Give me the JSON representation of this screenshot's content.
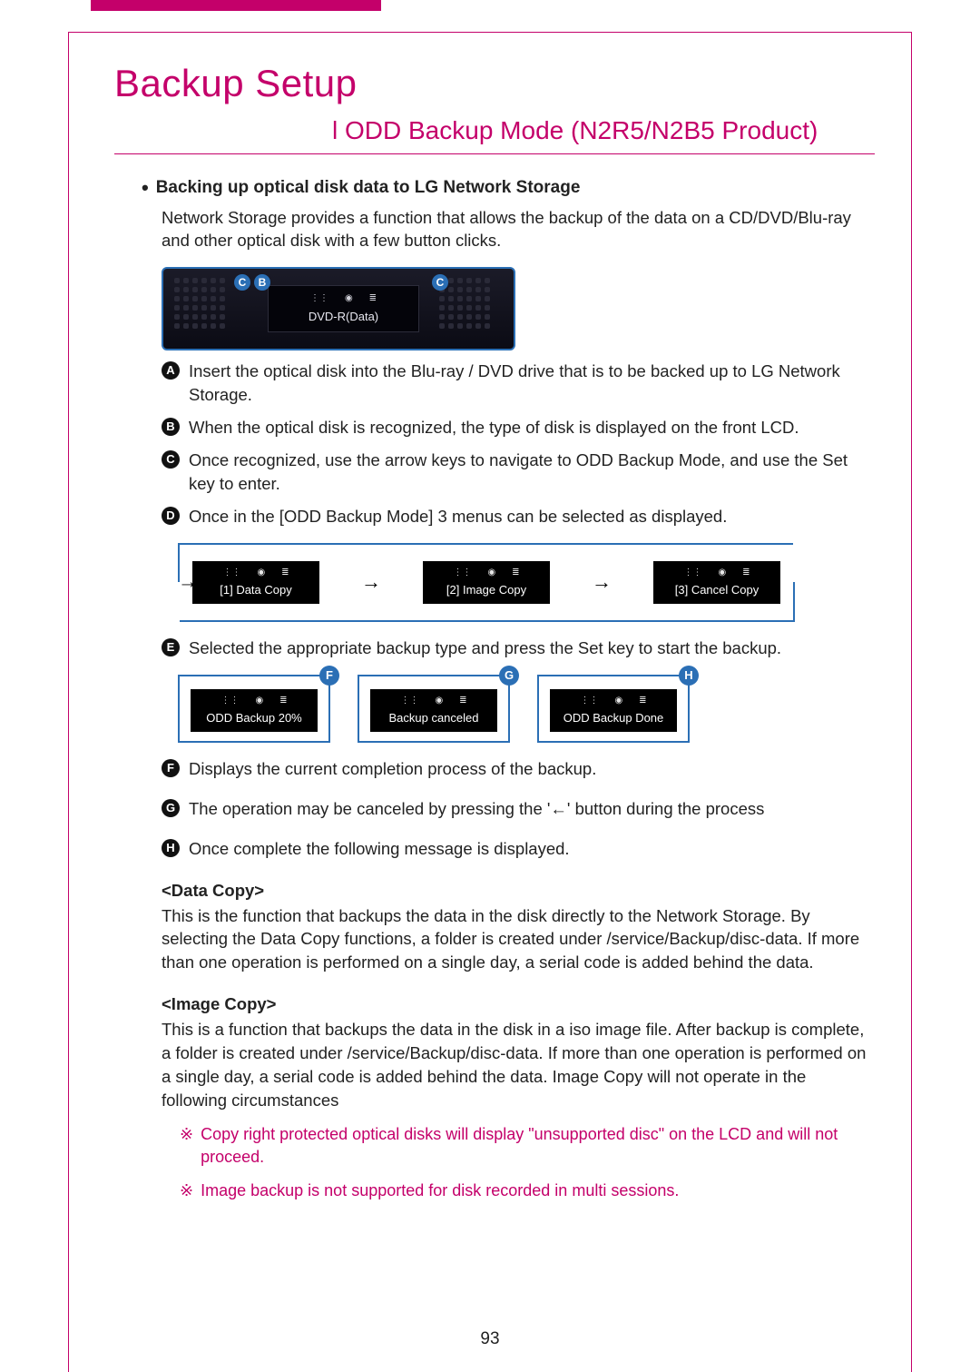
{
  "header": {
    "title": "Backup Setup",
    "subtitle_prefix": "l ",
    "subtitle": "ODD Backup Mode (N2R5/N2B5 Product)"
  },
  "intro": {
    "bullet": "Backing up optical disk data to LG Network Storage",
    "text": "Network Storage provides a function that allows the backup of the data on a CD/DVD/Blu-ray and other optical disk with a few button clicks."
  },
  "device": {
    "lcd_text": "DVD-R(Data)",
    "callouts": {
      "c": "C",
      "b": "B",
      "c2": "C"
    }
  },
  "steps": {
    "a": {
      "letter": "A",
      "text": "Insert the optical disk into the Blu-ray / DVD drive that is to be backed up to LG Network Storage."
    },
    "b": {
      "letter": "B",
      "text": "When the optical disk is recognized, the type of disk is displayed on the front LCD."
    },
    "c": {
      "letter": "C",
      "text": "Once recognized, use the arrow keys to navigate to ODD Backup Mode, and use the Set key to enter."
    },
    "d": {
      "letter": "D",
      "text": "Once in the [ODD Backup Mode] 3 menus can be selected as displayed."
    },
    "e": {
      "letter": "E",
      "text": "Selected the appropriate backup type and press the Set key to start the backup."
    },
    "f": {
      "letter": "F",
      "text": "Displays the current completion process of the backup."
    },
    "g": {
      "letter": "G",
      "text": "The operation may be canceled by pressing the '←' button during the process"
    },
    "h": {
      "letter": "H",
      "text": "Once complete the following message is displayed."
    }
  },
  "menu_lcds": {
    "m1": "[1] Data Copy",
    "m2": "[2] Image Copy",
    "m3": "[3] Cancel Copy"
  },
  "status_lcds": {
    "f": {
      "label": "F",
      "text": "ODD Backup 20%"
    },
    "g": {
      "label": "G",
      "text": "Backup canceled"
    },
    "h": {
      "label": "H",
      "text": "ODD Backup Done"
    }
  },
  "sections": {
    "data_copy": {
      "head": "<Data Copy>",
      "body": "This is the function that backups the data in the disk directly to the Network Storage. By selecting the Data Copy functions, a folder is created under /service/Backup/disc-data. If more than one operation is performed on a single day, a serial code is added behind the data."
    },
    "image_copy": {
      "head": "<Image Copy>",
      "body": "This is a function that backups the data in the disk in a iso image file. After backup is complete, a folder is created under /service/Backup/disc-data. If more than one operation is performed on a single day, a serial code is added behind the data. Image Copy will not operate in the following circumstances"
    }
  },
  "notes": {
    "mark": "※",
    "n1": "Copy right protected optical disks will display \"unsupported disc\" on the LCD and will not proceed.",
    "n2": "Image backup is not supported for disk recorded in multi sessions."
  },
  "page_number": "93"
}
